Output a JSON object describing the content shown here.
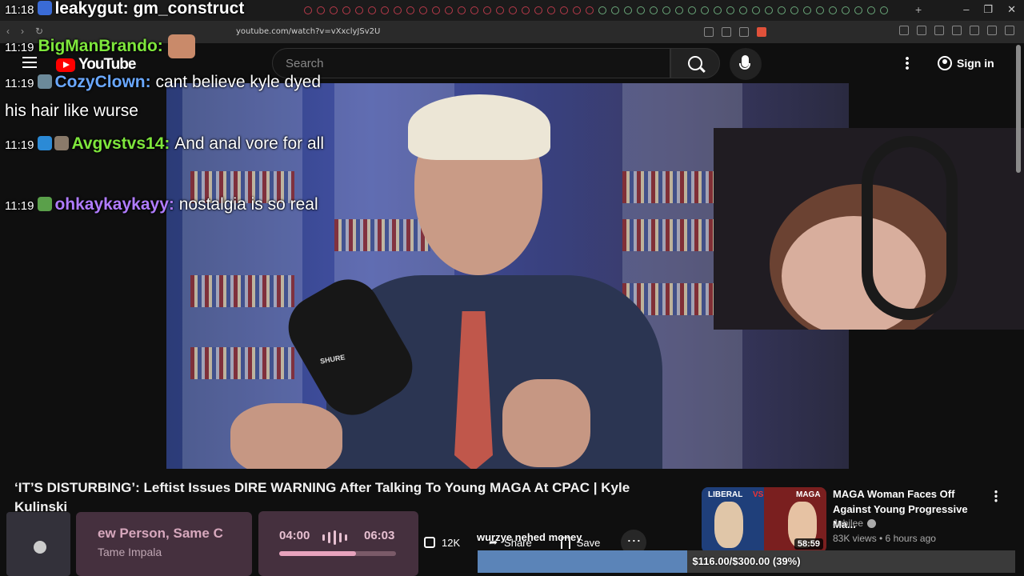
{
  "browser": {
    "url": "youtube.com/watch?v=vXxclyJSv2U"
  },
  "youtube": {
    "logo_text": "YouTube",
    "search_placeholder": "Search",
    "sign_in": "Sign in"
  },
  "chat": [
    {
      "time": "11:18",
      "user": "leakygut",
      "text": "gm_construct",
      "color": "#ffffff"
    },
    {
      "time": "11:19",
      "user": "BigManBrando",
      "text": "",
      "color": "#7ee63c"
    },
    {
      "time": "11:19",
      "user": "CozyClown",
      "text": "cant believe kyle dyed his hair like wurse",
      "color": "#6aa8ff"
    },
    {
      "time": "11:19",
      "user": "Avgvstvs14",
      "text": "And anal vore for all",
      "color": "#7ee63c"
    },
    {
      "time": "11:19",
      "user": "ohkaykaykayy",
      "text": "nostalgia is so real",
      "color": "#b07cff"
    }
  ],
  "video": {
    "title": "‘IT’S DISTURBING’: Leftist Issues DIRE WARNING After Talking To Young MAGA At CPAC | Kyle Kulinski",
    "likes": "12K",
    "share_label": "Share",
    "save_label": "Save",
    "mic_brand": "SHURE"
  },
  "recommendation": {
    "title": "MAGA Woman Faces Off Against Young Progressive Ma...",
    "channel": "Jubilee",
    "meta": "83K views • 6 hours ago",
    "duration": "58:59",
    "thumb_left": "LIBERAL",
    "thumb_vs": "VS",
    "thumb_right": "MAGA"
  },
  "now_playing": {
    "song": "ew Person, Same C",
    "artist": "Tame Impala",
    "elapsed": "04:00",
    "total": "06:03",
    "progress": 0.66
  },
  "donation": {
    "latest": "wurzye nehed money",
    "goal_text": "$116.00/$300.00 (39%)",
    "progress": 0.39
  }
}
